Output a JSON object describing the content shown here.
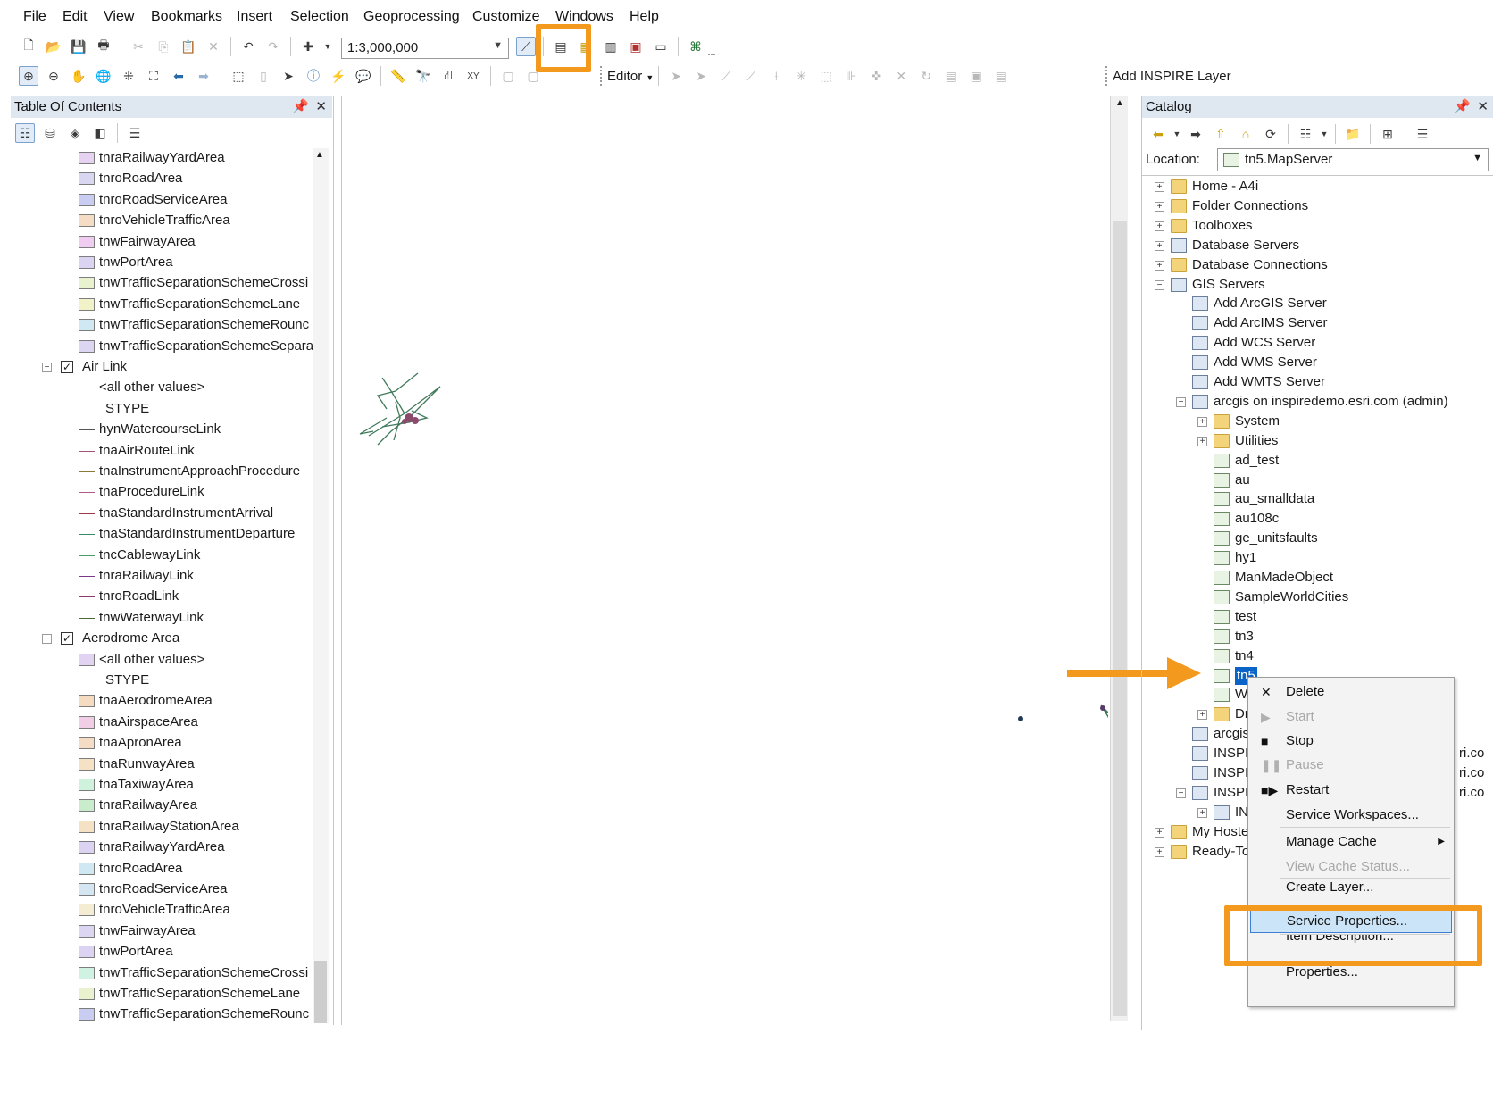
{
  "menu": [
    "File",
    "Edit",
    "View",
    "Bookmarks",
    "Insert",
    "Selection",
    "Geoprocessing",
    "Customize",
    "Windows",
    "Help"
  ],
  "toolbar": {
    "scale": "1:3,000,000",
    "editor_label": "Editor",
    "add_inspire_label": "Add INSPIRE Layer"
  },
  "toc": {
    "title": "Table Of Contents",
    "items": [
      {
        "type": "fill",
        "label": "tnraRailwayYardArea",
        "color": "#e6d3f2"
      },
      {
        "type": "fill",
        "label": "tnroRoadArea",
        "color": "#d9d6f2"
      },
      {
        "type": "fill",
        "label": "tnroRoadServiceArea",
        "color": "#c9cdf2"
      },
      {
        "type": "fill",
        "label": "tnroVehicleTrafficArea",
        "color": "#f5dcc4"
      },
      {
        "type": "fill",
        "label": "tnwFairwayArea",
        "color": "#f0cdf0"
      },
      {
        "type": "fill",
        "label": "tnwPortArea",
        "color": "#dcd3f2"
      },
      {
        "type": "fill",
        "label": "tnwTrafficSeparationSchemeCrossi",
        "color": "#e8f2cf"
      },
      {
        "type": "fill",
        "label": "tnwTrafficSeparationSchemeLane",
        "color": "#f2f2c9"
      },
      {
        "type": "fill",
        "label": "tnwTrafficSeparationSchemeRounc",
        "color": "#cfe8f2"
      },
      {
        "type": "fill",
        "label": "tnwTrafficSeparationSchemeSepara",
        "color": "#dcd6f2"
      },
      {
        "type": "group",
        "label": "Air Link"
      },
      {
        "type": "line",
        "label": "<all other values>",
        "color": "#a06080"
      },
      {
        "type": "text",
        "label": "STYPE"
      },
      {
        "type": "line",
        "label": "hynWatercourseLink",
        "color": "#555555"
      },
      {
        "type": "line",
        "label": "tnaAirRouteLink",
        "color": "#a0527a"
      },
      {
        "type": "line",
        "label": "tnaInstrumentApproachProcedure",
        "color": "#8c7a3a"
      },
      {
        "type": "line",
        "label": "tnaProcedureLink",
        "color": "#b05a8a"
      },
      {
        "type": "line",
        "label": "tnaStandardInstrumentArrival",
        "color": "#a03a4a"
      },
      {
        "type": "line",
        "label": "tnaStandardInstrumentDeparture",
        "color": "#3a8a6a"
      },
      {
        "type": "line",
        "label": "tncCablewayLink",
        "color": "#4a9a6a"
      },
      {
        "type": "line",
        "label": "tnraRailwayLink",
        "color": "#7a3a8a"
      },
      {
        "type": "line",
        "label": "tnroRoadLink",
        "color": "#8a3a6a"
      },
      {
        "type": "line",
        "label": "tnwWaterwayLink",
        "color": "#4a6a3a"
      },
      {
        "type": "group",
        "label": "Aerodrome Area"
      },
      {
        "type": "fill",
        "label": "<all other values>",
        "color": "#e2d3f2"
      },
      {
        "type": "text",
        "label": "STYPE"
      },
      {
        "type": "fill",
        "label": "tnaAerodromeArea",
        "color": "#f5dcc0"
      },
      {
        "type": "fill",
        "label": "tnaAirspaceArea",
        "color": "#f2cde6"
      },
      {
        "type": "fill",
        "label": "tnaApronArea",
        "color": "#f5dcc4"
      },
      {
        "type": "fill",
        "label": "tnaRunwayArea",
        "color": "#f5e2c4"
      },
      {
        "type": "fill",
        "label": "tnaTaxiwayArea",
        "color": "#cff2dc"
      },
      {
        "type": "fill",
        "label": "tnraRailwayArea",
        "color": "#c8eccc"
      },
      {
        "type": "fill",
        "label": "tnraRailwayStationArea",
        "color": "#f5e2c4"
      },
      {
        "type": "fill",
        "label": "tnraRailwayYardArea",
        "color": "#dcd3f2"
      },
      {
        "type": "fill",
        "label": "tnroRoadArea",
        "color": "#cfe8f2"
      },
      {
        "type": "fill",
        "label": "tnroRoadServiceArea",
        "color": "#d3e6f2"
      },
      {
        "type": "fill",
        "label": "tnroVehicleTrafficArea",
        "color": "#f5ecd4"
      },
      {
        "type": "fill",
        "label": "tnwFairwayArea",
        "color": "#dcd6f2"
      },
      {
        "type": "fill",
        "label": "tnwPortArea",
        "color": "#dcd3f2"
      },
      {
        "type": "fill",
        "label": "tnwTrafficSeparationSchemeCrossi",
        "color": "#cff2e2"
      },
      {
        "type": "fill",
        "label": "tnwTrafficSeparationSchemeLane",
        "color": "#e8f2cf"
      },
      {
        "type": "fill",
        "label": "tnwTrafficSeparationSchemeRounc",
        "color": "#c9cdf2"
      }
    ]
  },
  "catalog": {
    "title": "Catalog",
    "location_label": "Location:",
    "location_value": "tn5.MapServer",
    "tree": [
      {
        "label": "Home - A4i",
        "indent": 0,
        "exp": "+",
        "icon": "folder"
      },
      {
        "label": "Folder Connections",
        "indent": 0,
        "exp": "+",
        "icon": "folder"
      },
      {
        "label": "Toolboxes",
        "indent": 0,
        "exp": "+",
        "icon": "folder"
      },
      {
        "label": "Database Servers",
        "indent": 0,
        "exp": "+",
        "icon": "srv"
      },
      {
        "label": "Database Connections",
        "indent": 0,
        "exp": "+",
        "icon": "folder"
      },
      {
        "label": "GIS Servers",
        "indent": 0,
        "exp": "-",
        "icon": "srv"
      },
      {
        "label": "Add ArcGIS Server",
        "indent": 1,
        "exp": "",
        "icon": "srv"
      },
      {
        "label": "Add ArcIMS Server",
        "indent": 1,
        "exp": "",
        "icon": "srv"
      },
      {
        "label": "Add WCS Server",
        "indent": 1,
        "exp": "",
        "icon": "srv"
      },
      {
        "label": "Add WMS Server",
        "indent": 1,
        "exp": "",
        "icon": "srv"
      },
      {
        "label": "Add WMTS Server",
        "indent": 1,
        "exp": "",
        "icon": "srv"
      },
      {
        "label": "arcgis on inspiredemo.esri.com (admin)",
        "indent": 1,
        "exp": "-",
        "icon": "srv"
      },
      {
        "label": "System",
        "indent": 2,
        "exp": "+",
        "icon": "folder"
      },
      {
        "label": "Utilities",
        "indent": 2,
        "exp": "+",
        "icon": "folder"
      },
      {
        "label": "ad_test",
        "indent": 2,
        "exp": "",
        "icon": "svc"
      },
      {
        "label": "au",
        "indent": 2,
        "exp": "",
        "icon": "svc"
      },
      {
        "label": "au_smalldata",
        "indent": 2,
        "exp": "",
        "icon": "svc"
      },
      {
        "label": "au108c",
        "indent": 2,
        "exp": "",
        "icon": "svc"
      },
      {
        "label": "ge_unitsfaults",
        "indent": 2,
        "exp": "",
        "icon": "svc"
      },
      {
        "label": "hy1",
        "indent": 2,
        "exp": "",
        "icon": "svc"
      },
      {
        "label": "ManMadeObject",
        "indent": 2,
        "exp": "",
        "icon": "svc"
      },
      {
        "label": "SampleWorldCities",
        "indent": 2,
        "exp": "",
        "icon": "svc"
      },
      {
        "label": "test",
        "indent": 2,
        "exp": "",
        "icon": "svc"
      },
      {
        "label": "tn3",
        "indent": 2,
        "exp": "",
        "icon": "svc"
      },
      {
        "label": "tn4",
        "indent": 2,
        "exp": "",
        "icon": "svc"
      },
      {
        "label": "tn5",
        "indent": 2,
        "exp": "",
        "icon": "svc",
        "selected": true
      },
      {
        "label": "W",
        "indent": 2,
        "exp": "",
        "icon": "svc"
      },
      {
        "label": "Dr",
        "indent": 2,
        "exp": "+",
        "icon": "folder"
      },
      {
        "label": "arcgis",
        "indent": 1,
        "exp": "",
        "icon": "srv"
      },
      {
        "label": "INSPII",
        "indent": 1,
        "exp": "",
        "icon": "srv",
        "tail": "ri.co"
      },
      {
        "label": "INSPII",
        "indent": 1,
        "exp": "",
        "icon": "srv",
        "tail": "ri.co"
      },
      {
        "label": "INSPII",
        "indent": 1,
        "exp": "-",
        "icon": "srv",
        "tail": "ri.co"
      },
      {
        "label": "IN",
        "indent": 2,
        "exp": "+",
        "icon": "srv"
      },
      {
        "label": "My Hoste",
        "indent": 0,
        "exp": "+",
        "icon": "folder"
      },
      {
        "label": "Ready-To",
        "indent": 0,
        "exp": "+",
        "icon": "folder"
      }
    ]
  },
  "context_menu": [
    {
      "label": "Delete",
      "glyph": "✕",
      "disabled": false
    },
    {
      "label": "Start",
      "glyph": "▶",
      "disabled": true
    },
    {
      "label": "Stop",
      "glyph": "■",
      "disabled": false
    },
    {
      "label": "Pause",
      "glyph": "❚❚",
      "disabled": true
    },
    {
      "label": "Restart",
      "glyph": "■▶",
      "disabled": false
    },
    {
      "label": "Service Workspaces...",
      "glyph": "",
      "disabled": false
    },
    {
      "label": "Manage Cache",
      "glyph": "",
      "disabled": false,
      "submenu": true
    },
    {
      "label": "View Cache Status...",
      "glyph": "",
      "disabled": true
    },
    {
      "label": "Create Layer...",
      "glyph": "",
      "disabled": false,
      "partial": true
    },
    {
      "label": "Service Properties...",
      "glyph": "",
      "disabled": false,
      "highlighted": true
    },
    {
      "label": "Item Description...",
      "glyph": "",
      "disabled": false,
      "partial": true
    },
    {
      "label": "Properties...",
      "glyph": "",
      "disabled": false
    }
  ],
  "colors": {
    "highlight": "#f39a1e",
    "selection": "#cce4f7",
    "selection_border": "#3c7fd1",
    "pane_title": "#dfe7f1"
  }
}
